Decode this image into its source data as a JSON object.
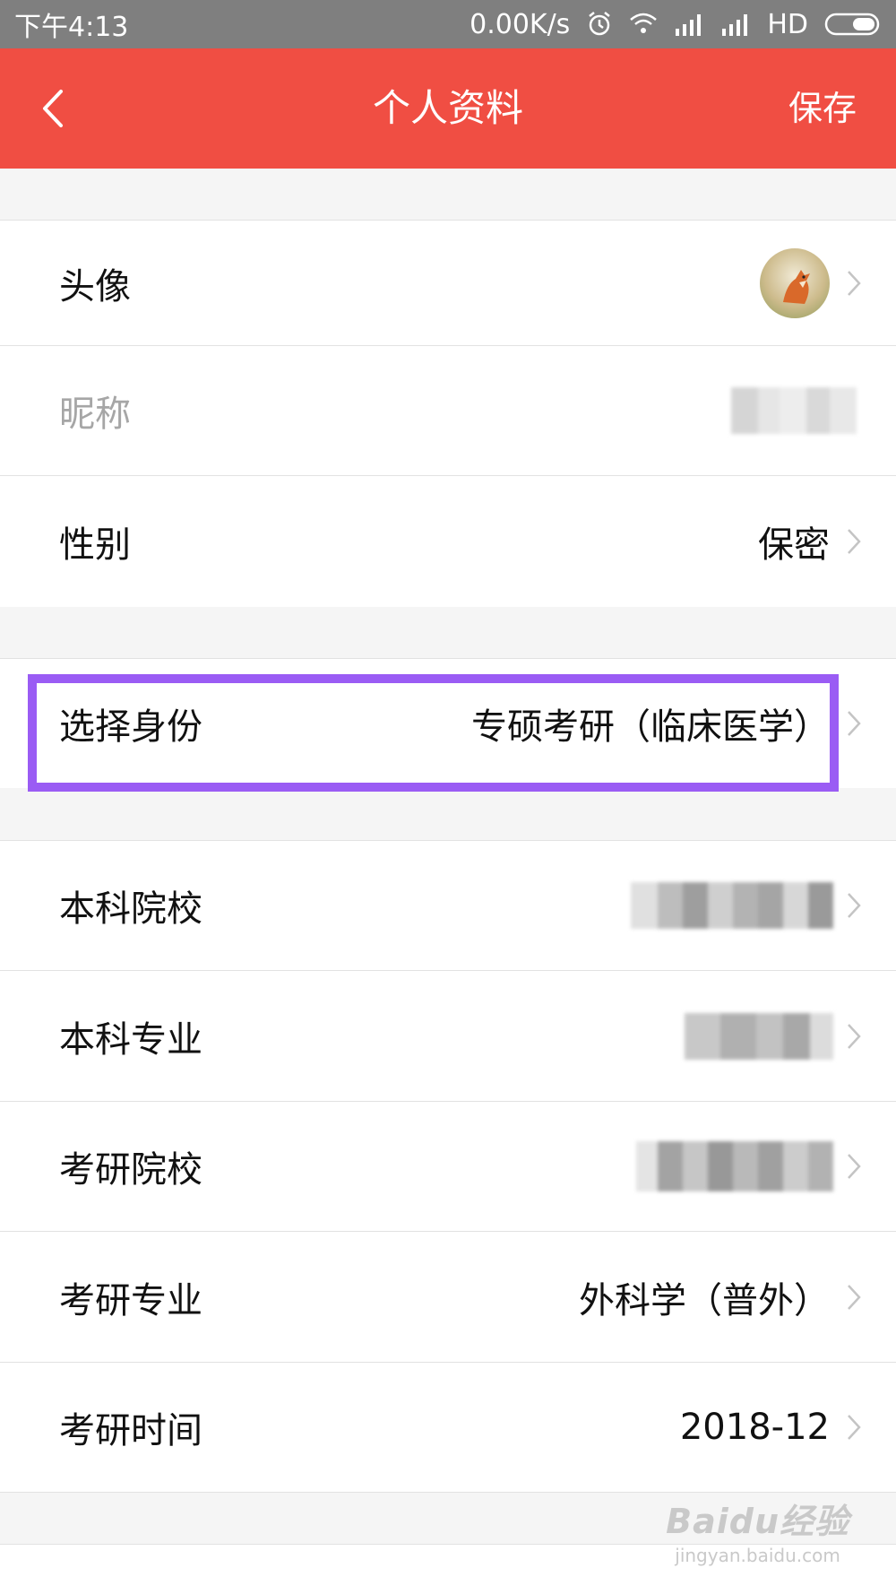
{
  "status_bar": {
    "time": "下午4:13",
    "network_speed": "0.00K/s",
    "network_type": "HD",
    "icons": [
      "alarm-icon",
      "wifi-icon",
      "signal-icon",
      "signal-icon",
      "battery-icon"
    ]
  },
  "header": {
    "title": "个人资料",
    "save_label": "保存",
    "back_icon": "back-arrow-icon",
    "background_color": "#f04e43"
  },
  "profile": {
    "rows": [
      {
        "label": "头像",
        "value": "",
        "type": "avatar",
        "muted": false
      },
      {
        "label": "昵称",
        "value": "",
        "type": "blurred",
        "muted": true
      },
      {
        "label": "性别",
        "value": "保密",
        "type": "text",
        "muted": false
      },
      {
        "label": "选择身份",
        "value": "专硕考研（临床医学）",
        "type": "text",
        "muted": false,
        "highlighted": true
      },
      {
        "label": "本科院校",
        "value": "",
        "type": "blurred",
        "muted": false
      },
      {
        "label": "本科专业",
        "value": "",
        "type": "blurred",
        "muted": false
      },
      {
        "label": "考研院校",
        "value": "",
        "type": "blurred",
        "muted": false
      },
      {
        "label": "考研专业",
        "value": "外科学（普外）",
        "type": "text",
        "muted": false
      },
      {
        "label": "考研时间",
        "value": "2018-12",
        "type": "text",
        "muted": false
      }
    ],
    "highlight_color": "#9a5cf4"
  },
  "watermark": {
    "main": "Baidu经验",
    "sub": "jingyan.baidu.com"
  }
}
